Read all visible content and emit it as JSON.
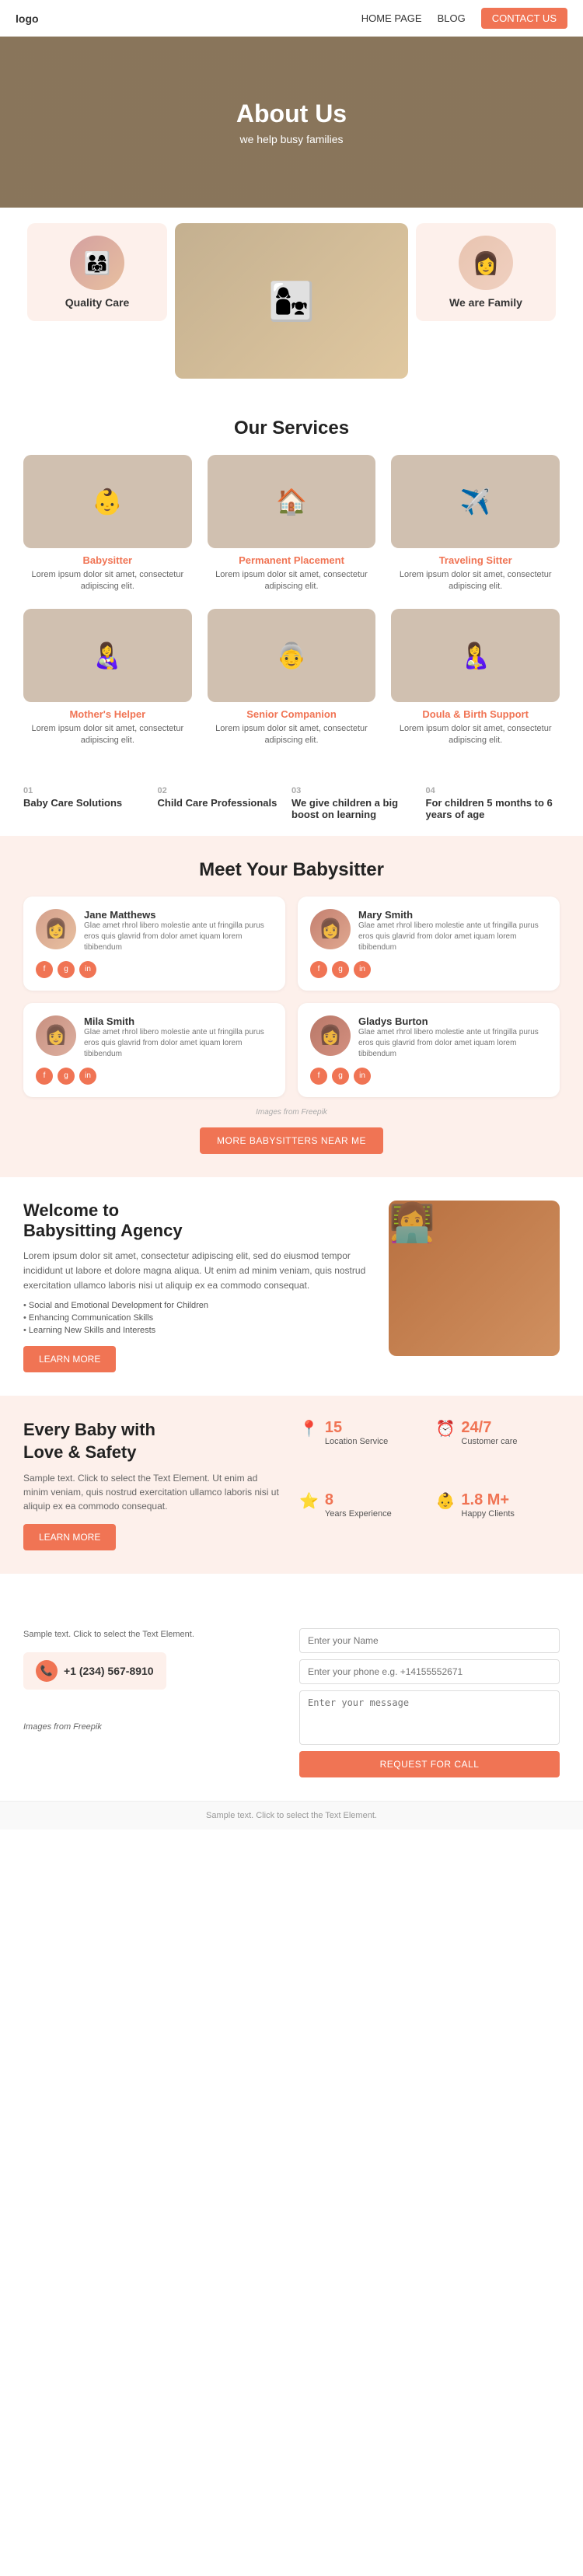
{
  "nav": {
    "logo": "logo",
    "links": [
      {
        "label": "HOME PAGE",
        "href": "#"
      },
      {
        "label": "BLOG",
        "href": "#"
      }
    ],
    "cta_label": "CONTACT US"
  },
  "hero": {
    "title": "About Us",
    "subtitle": "we help busy families"
  },
  "features": [
    {
      "id": "quality-care",
      "title": "Quality Care",
      "img_class": "img-family"
    },
    {
      "id": "center",
      "img_class": "img-mom-child"
    },
    {
      "id": "we-are-family",
      "title": "We are Family",
      "img_class": "img-woman"
    }
  ],
  "services": {
    "heading": "Our Services",
    "items": [
      {
        "title": "Babysitter",
        "img_class": "img-babysit",
        "desc": "Lorem ipsum dolor sit amet, consectetur adipiscing elit."
      },
      {
        "title": "Permanent Placement",
        "img_class": "img-perm",
        "desc": "Lorem ipsum dolor sit amet, consectetur adipiscing elit."
      },
      {
        "title": "Traveling Sitter",
        "img_class": "img-travel",
        "desc": "Lorem ipsum dolor sit amet, consectetur adipiscing elit."
      },
      {
        "title": "Mother's Helper",
        "img_class": "img-mother",
        "desc": "Lorem ipsum dolor sit amet, consectetur adipiscing elit."
      },
      {
        "title": "Senior Companion",
        "img_class": "img-senior",
        "desc": "Lorem ipsum dolor sit amet, consectetur adipiscing elit."
      },
      {
        "title": "Doula & Birth Support",
        "img_class": "img-doula",
        "desc": "Lorem ipsum dolor sit amet, consectetur adipiscing elit."
      }
    ]
  },
  "stats_row": [
    {
      "num": "01",
      "label": "Baby Care Solutions"
    },
    {
      "num": "02",
      "label": "Child Care Professionals"
    },
    {
      "num": "03",
      "label": "We give children a big boost on learning"
    },
    {
      "num": "04",
      "label": "For children 5 months to 6 years of age"
    }
  ],
  "meet": {
    "heading": "Meet Your Babysitter",
    "babysitters": [
      {
        "name": "Jane Matthews",
        "avatar_class": "avatar-jane",
        "text": "Glae amet rhrol libero molestie ante ut fringilla purus eros quis glavrid from dolor amet iquam lorem tibibendum",
        "socials": [
          "f",
          "g",
          "in"
        ]
      },
      {
        "name": "Mary Smith",
        "avatar_class": "avatar-mary",
        "text": "Glae amet rhrol libero molestie ante ut fringilla purus eros quis glavrid from dolor amet iquam lorem tibibendum",
        "socials": [
          "f",
          "g",
          "in"
        ]
      },
      {
        "name": "Mila Smith",
        "avatar_class": "avatar-mila",
        "text": "Glae amet rhrol libero molestie ante ut fringilla purus eros quis glavrid from dolor amet iquam lorem tibibendum",
        "socials": [
          "f",
          "g",
          "in"
        ]
      },
      {
        "name": "Gladys Burton",
        "avatar_class": "avatar-gladys",
        "text": "Glae amet rhrol libero molestie ante ut fringilla purus eros quis glavrid from dolor amet iquam lorem tibibendum",
        "socials": [
          "f",
          "g",
          "in"
        ]
      }
    ],
    "freepik_note": "Images from Freepik",
    "more_btn": "MORE BABYSITTERS NEAR ME"
  },
  "welcome": {
    "heading": "Welcome to\nBabysitting Agency",
    "text": "Lorem ipsum dolor sit amet, consectetur adipiscing elit, sed do eiusmod tempor incididunt ut labore et dolore magna aliqua. Ut enim ad minim veniam, quis nostrud exercitation ullamco laboris nisi ut aliquip ex ea commodo consequat.",
    "list": [
      "Social and Emotional Development for Children",
      "Enhancing Communication Skills",
      "Learning New Skills and Interests"
    ],
    "learn_btn": "LEARN MORE",
    "img_class": "img-welcome"
  },
  "every_baby": {
    "heading": "Every Baby with\nLove & Safety",
    "text": "Sample text. Click to select the Text Element. Ut enim ad minim veniam, quis nostrud exercitation ullamco laboris nisi ut aliquip ex ea commodo consequat.",
    "learn_btn": "LEARN MORE",
    "stats": [
      {
        "icon": "📍",
        "num": "15",
        "label": "Location Service"
      },
      {
        "icon": "⏰",
        "num": "24/7",
        "label": "Customer care"
      },
      {
        "icon": "⭐",
        "num": "8",
        "label": "Years Experience"
      },
      {
        "icon": "👶",
        "num": "1.8 M+",
        "label": "Happy Clients"
      }
    ]
  },
  "footer_form": {
    "left_text": "Sample text. Click to select the Text Element.",
    "phone": "+1 (234) 567-8910",
    "freepik_note": "Images from Freepik",
    "form": {
      "name_placeholder": "Enter your Name",
      "phone_placeholder": "Enter your phone e.g. +14155552671",
      "message_placeholder": "Enter your message",
      "submit_label": "REQUEST FOR CALL"
    }
  },
  "bottom_bar": {
    "text": "Sample text. Click to select the Text Element."
  }
}
